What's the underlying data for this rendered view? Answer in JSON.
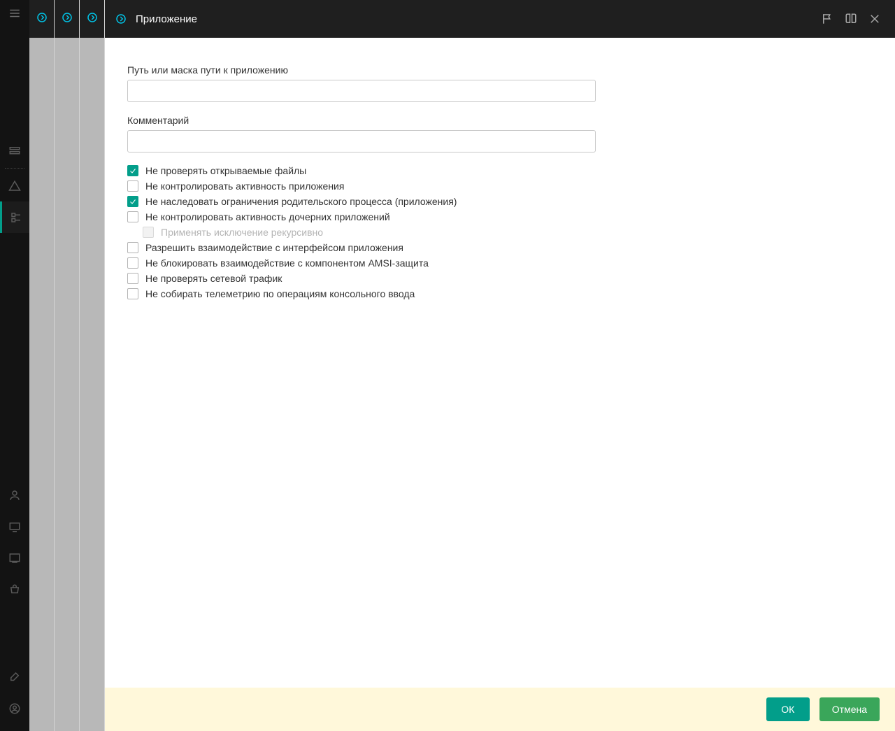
{
  "header": {
    "title": "Приложение"
  },
  "form": {
    "path_label": "Путь или маска пути к приложению",
    "path_value": "",
    "comment_label": "Комментарий",
    "comment_value": ""
  },
  "checks": [
    {
      "label": "Не проверять открываемые файлы",
      "checked": true,
      "indent": false,
      "disabled": false
    },
    {
      "label": "Не контролировать активность приложения",
      "checked": false,
      "indent": false,
      "disabled": false
    },
    {
      "label": "Не наследовать ограничения родительского процесса (приложения)",
      "checked": true,
      "indent": false,
      "disabled": false
    },
    {
      "label": "Не контролировать активность дочерних приложений",
      "checked": false,
      "indent": false,
      "disabled": false
    },
    {
      "label": "Применять исключение рекурсивно",
      "checked": false,
      "indent": true,
      "disabled": true
    },
    {
      "label": "Разрешить взаимодействие с интерфейсом приложения",
      "checked": false,
      "indent": false,
      "disabled": false
    },
    {
      "label": "Не блокировать взаимодействие с компонентом AMSI-защита",
      "checked": false,
      "indent": false,
      "disabled": false
    },
    {
      "label": "Не проверять сетевой трафик",
      "checked": false,
      "indent": false,
      "disabled": false
    },
    {
      "label": "Не собирать телеметрию по операциям консольного ввода",
      "checked": false,
      "indent": false,
      "disabled": false
    }
  ],
  "footer": {
    "ok_label": "ОК",
    "cancel_label": "Отмена"
  },
  "icons": {
    "circle_chevron": "circle-chevron-right-icon"
  }
}
